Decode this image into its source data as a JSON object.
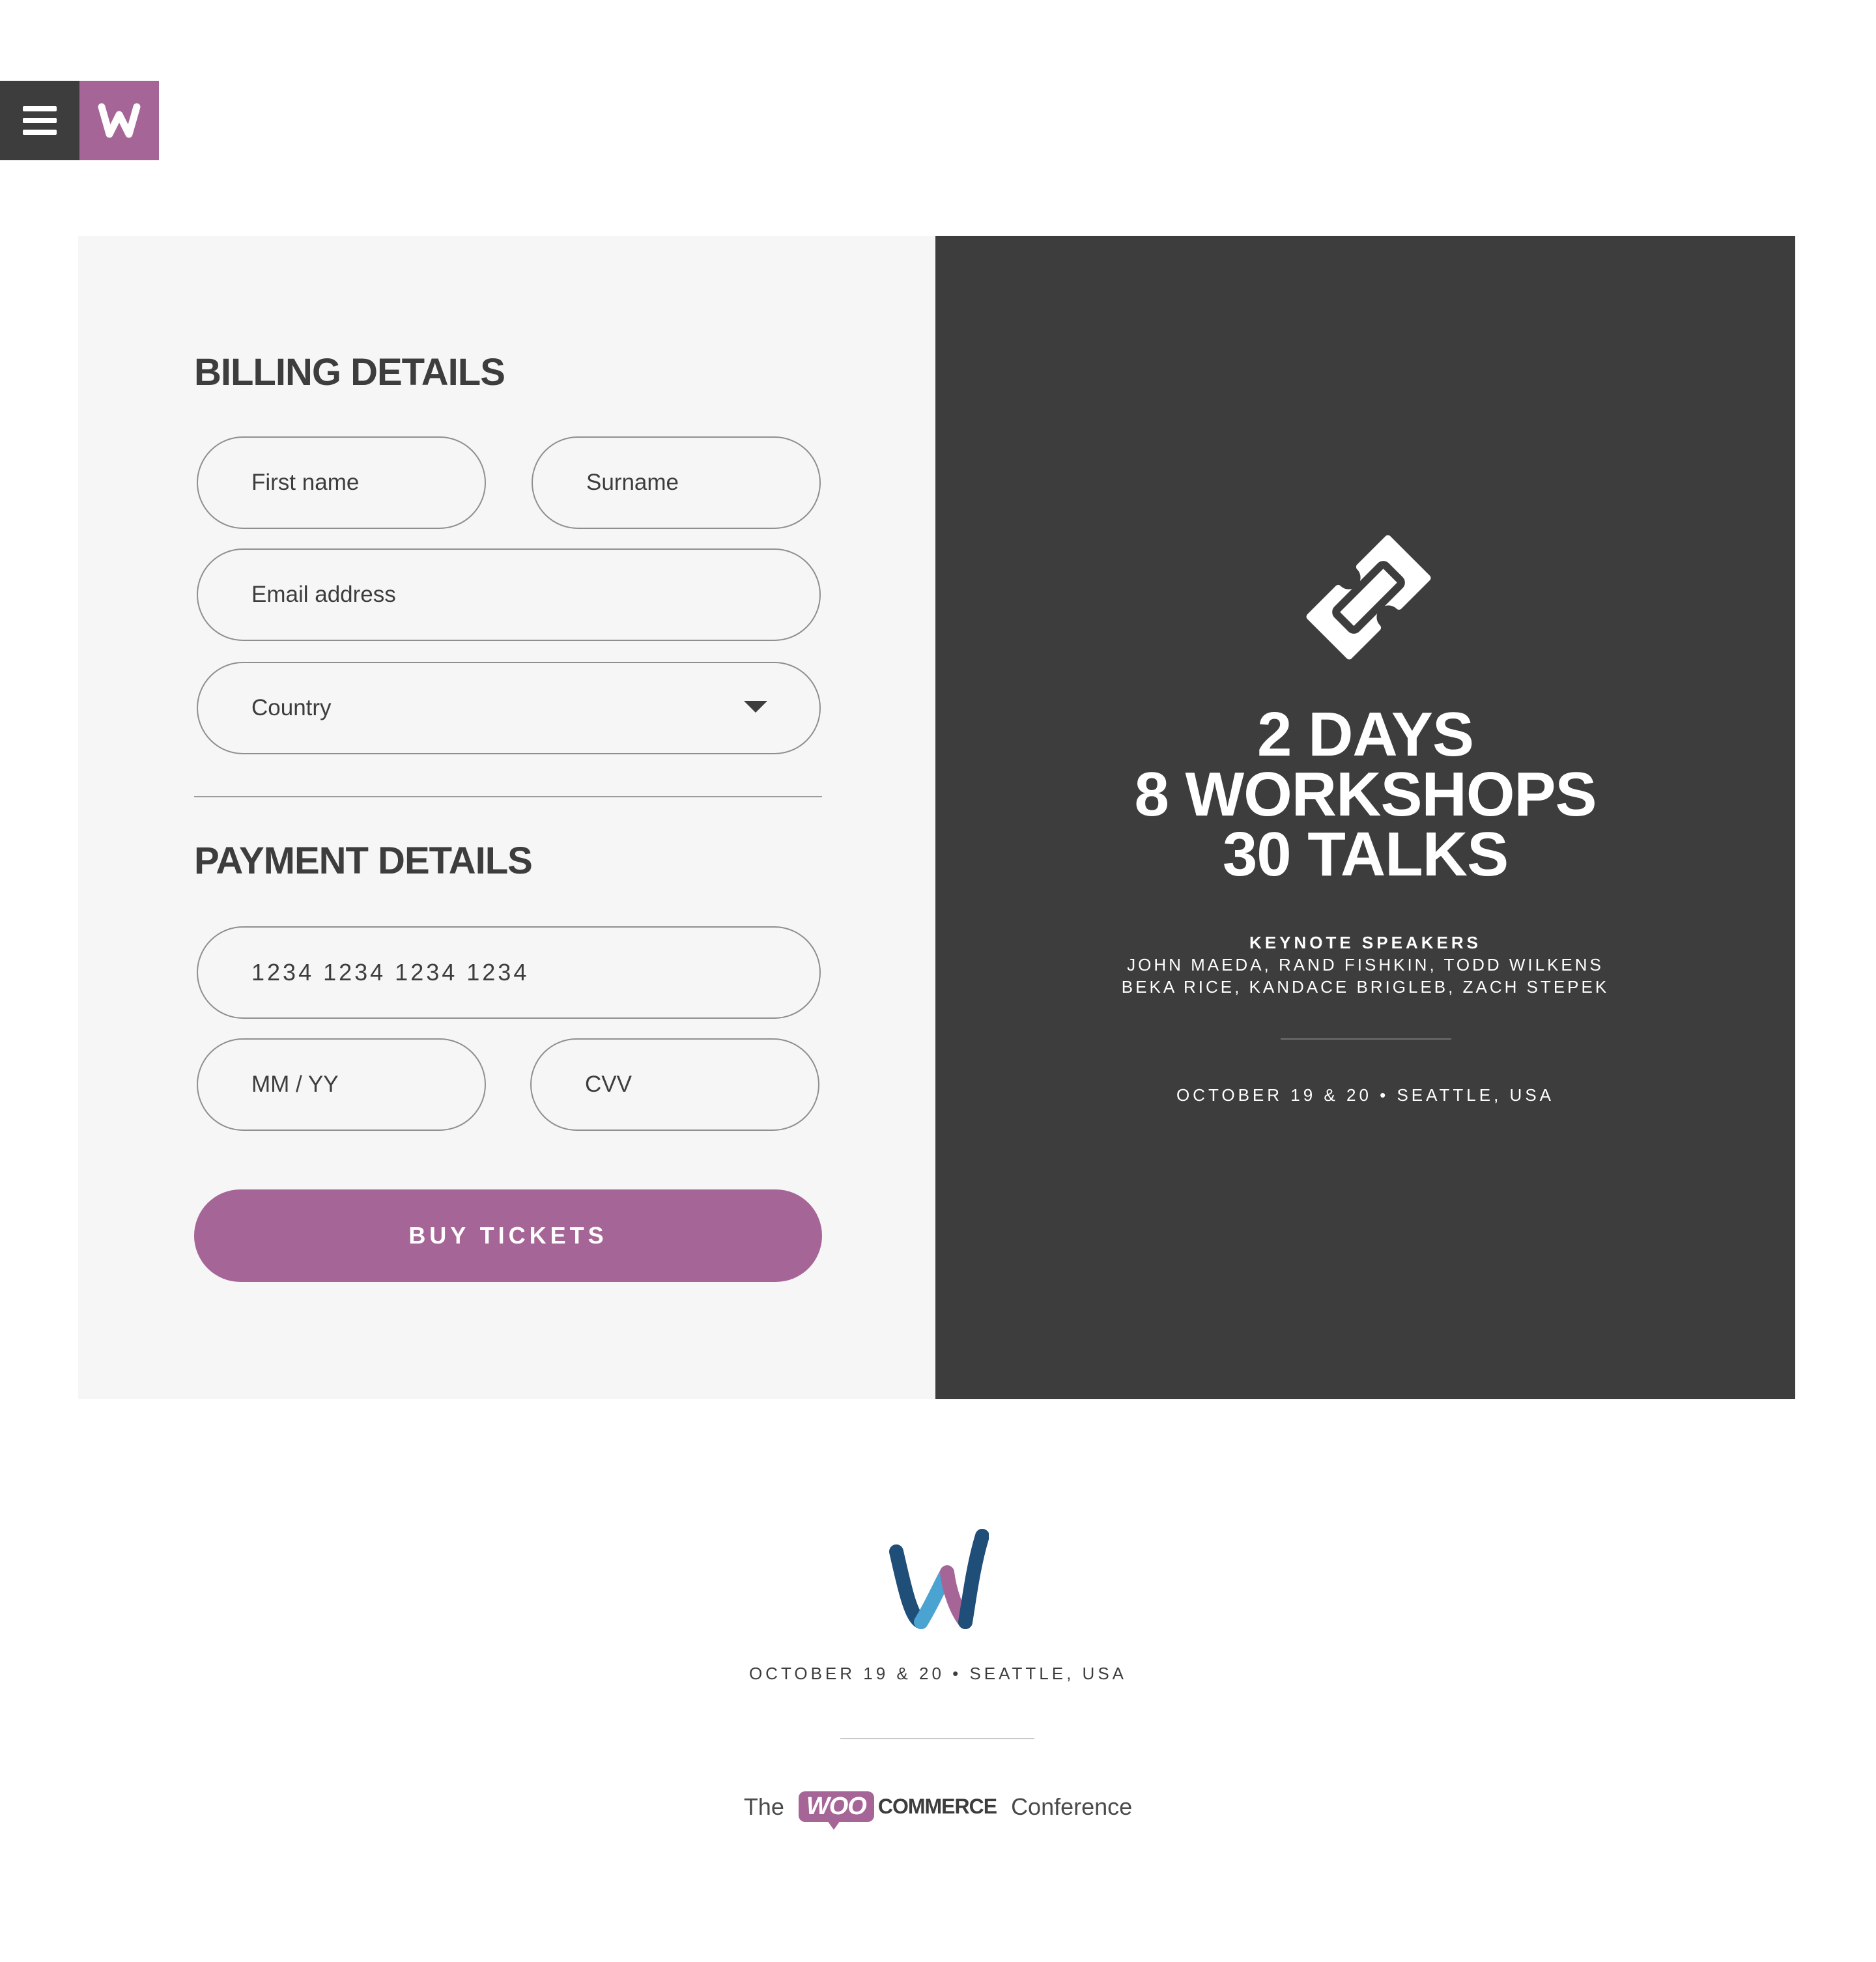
{
  "topbar": {
    "menu_icon": "hamburger-menu-icon",
    "brand_icon": "w-logo-icon",
    "brand_letter": "W"
  },
  "billing": {
    "title": "BILLING DETAILS",
    "first_name_placeholder": "First name",
    "surname_placeholder": "Surname",
    "email_placeholder": "Email address",
    "country_value": "Country"
  },
  "payment": {
    "title": "PAYMENT DETAILS",
    "card_number_placeholder": "1234 1234 1234 1234",
    "expiry_placeholder": "MM / YY",
    "cvv_placeholder": "CVV",
    "buy_label": "BUY TICKETS"
  },
  "promo": {
    "icon": "ticket-icon",
    "line1": "2 DAYS",
    "line2": "8 WORKSHOPS",
    "line3": "30 TALKS",
    "speakers_title": "KEYNOTE SPEAKERS",
    "speakers_line1": "JOHN MAEDA, RAND FISHKIN, TODD WILKENS",
    "speakers_line2": "BEKA RICE, KANDACE BRIGLEB, ZACH STEPEK",
    "date": "OCTOBER 19 & 20 • SEATTLE, USA"
  },
  "footer": {
    "logo_icon": "woo-conference-w-logo",
    "date": "OCTOBER 19 & 20 • SEATTLE, USA",
    "credit_prefix": "The",
    "woo": "WOO",
    "commerce": "COMMERCE",
    "credit_suffix": "Conference"
  },
  "colors": {
    "accent": "#a66597",
    "dark": "#3d3d3d",
    "panel": "#f6f6f6",
    "logo_blue_dark": "#1f4e79",
    "logo_blue_light": "#4aa3d0"
  }
}
